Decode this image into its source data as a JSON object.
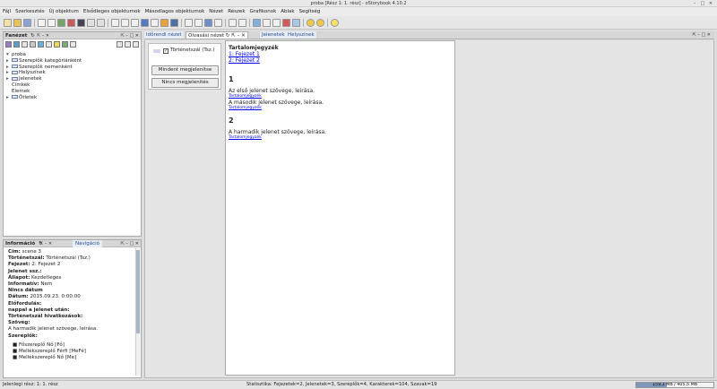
{
  "window": {
    "title": "proba [Rész 1: 1. rész] - oStorybook 4.10.2"
  },
  "menu": [
    "Fájl",
    "Szerkesztés",
    "Új objektum",
    "Elsődleges objektumok",
    "Másodlagos objektumok",
    "Nézet",
    "Részek",
    "Grafikonok",
    "Ablak",
    "Segítség"
  ],
  "tree_panel": {
    "title": "Fanézet",
    "items": [
      {
        "label": "proba",
        "level": 0,
        "folder": false
      },
      {
        "label": "Szereplők kategóriánként",
        "level": 1,
        "folder": true
      },
      {
        "label": "Szereplők nemenként",
        "level": 1,
        "folder": true
      },
      {
        "label": "Helyszínek",
        "level": 1,
        "folder": true
      },
      {
        "label": "Jelenetek",
        "level": 1,
        "folder": true
      },
      {
        "label": "Címkék",
        "level": 1,
        "folder": false
      },
      {
        "label": "Elemek",
        "level": 1,
        "folder": false
      },
      {
        "label": "Ötletek",
        "level": 1,
        "folder": true
      }
    ]
  },
  "info_panel": {
    "title": "Információ",
    "tab2": "Navigáció",
    "rows": [
      {
        "key": "Cím:",
        "value": " scene 3"
      },
      {
        "key": "Történetszál:",
        "value": " Történetszál (Tsz.)"
      },
      {
        "key": "Fejezet:",
        "value": " 2: Fejezet 2"
      },
      {
        "key": "Jelenet ssz.:",
        "value": ""
      },
      {
        "key": "Állapot:",
        "value": " Kezdetleges"
      },
      {
        "key": "Informatív:",
        "value": " Nem"
      },
      {
        "key": "Nincs dátum",
        "value": ""
      },
      {
        "key": "Dátum:",
        "value": " 2015.09.23. 0:00:00"
      },
      {
        "key": "Előfordulás:",
        "value": ""
      },
      {
        "key": "nappal a jelenet után:",
        "value": ""
      },
      {
        "key": "Történetszál hivatkozások:",
        "value": ""
      },
      {
        "key": "Szöveg:",
        "value": ""
      },
      {
        "key": "",
        "value": "A harmadik jelenet szövege, leírása."
      },
      {
        "key": "Szereplők:",
        "value": ""
      }
    ],
    "characters": [
      "Főszereplő Nő [Fő]",
      "Mellékszereplő Férfi [MeFé]",
      "Mellékszereplő Nő [Me]"
    ]
  },
  "tabs": {
    "left_cut": "Időrendi nézet",
    "active": "Olvasási nézet",
    "right1": "Jelenetek",
    "right2": "Helyszínek"
  },
  "reading": {
    "strand_checkbox": "Történetszál (Tsz.)",
    "show_all_button": "Mindent megjelenítse",
    "show_none_button": "Nincs megjelenítés",
    "toc_title": "Tartalomjegyzék",
    "toc_links": [
      "1: Fejezet 1",
      "2: Fejezet 2"
    ],
    "chapters": [
      {
        "number": "1",
        "scenes": [
          "Az első jelenet szövege, leírása.",
          "A második jelenet szövege, leírása."
        ]
      },
      {
        "number": "2",
        "scenes": [
          "A harmadik jelenet szövege, leírása."
        ]
      }
    ],
    "back_link": "Tartalomjegyzék"
  },
  "status": {
    "left": "Jelenlegi rész: 1: 1. rész",
    "center": "Statisztika: Fejezetek=2, Jelenetek=3, Szereplők=4, Karakterek=104, Szavak=19",
    "memory": "159,1 MB / 405,5 MB",
    "memory_fraction": 0.39
  }
}
